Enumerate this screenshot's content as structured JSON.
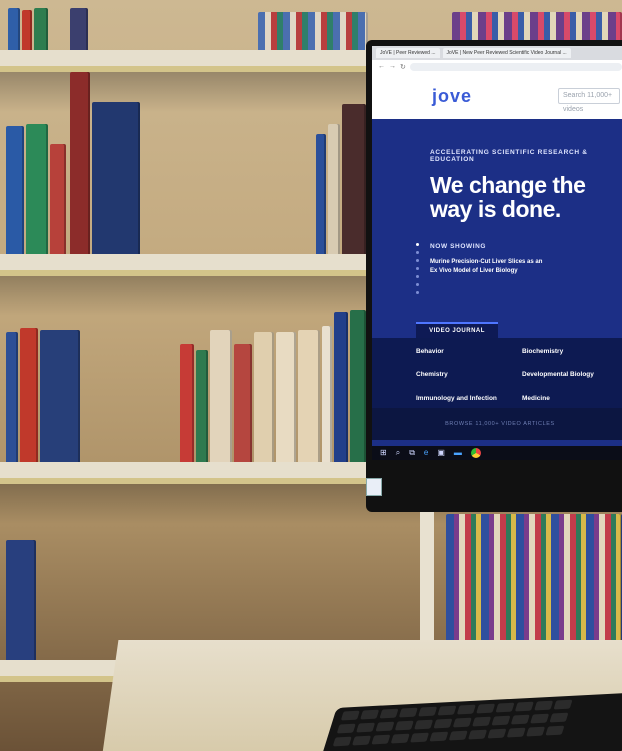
{
  "browser": {
    "tabs": [
      "JoVE | Peer Reviewed ...",
      "JoVE | New Peer Reviewed Scientific Video Journal ..."
    ],
    "search_placeholder": "Search 11,000+ videos"
  },
  "site": {
    "logo": "jove",
    "tagline": "ACCELERATING SCIENTIFIC RESEARCH & EDUCATION",
    "headline": "We change the way is done.",
    "now_showing_label": "NOW SHOWING",
    "now_showing_title": "Murine Precision-Cut Liver Slices as an Ex Vivo Model of Liver Biology",
    "journal_tab": "VIDEO JOURNAL",
    "journal_sections": [
      "Behavior",
      "Biochemistry",
      "Chemistry",
      "Developmental Biology",
      "Immunology and Infection",
      "Medicine"
    ],
    "articles_strip": "BROWSE 11,000+ VIDEO ARTICLES"
  },
  "colors": {
    "hero_blue": "#1c2f86",
    "panel_navy": "#0d1a52",
    "logo_blue": "#3a5bd6"
  }
}
